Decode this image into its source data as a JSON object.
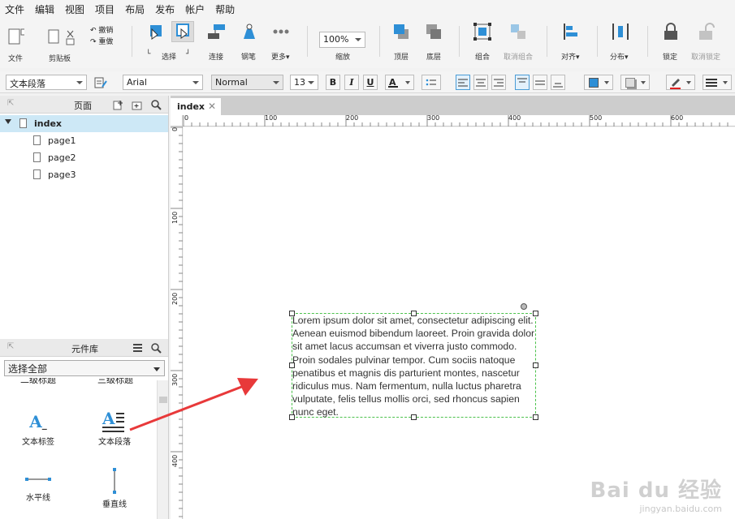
{
  "menu": [
    "文件",
    "编辑",
    "视图",
    "项目",
    "布局",
    "发布",
    "帐户",
    "帮助"
  ],
  "toolbar": {
    "file_label": "文件",
    "clipboard_label": "剪贴板",
    "undo_label": "撤销",
    "redo_label": "重做",
    "select_label": "选择",
    "connect_label": "连接",
    "pen_label": "钢笔",
    "more_label": "更多▾",
    "zoom_value": "100%",
    "zoom_label": "缩放",
    "top_label": "顶层",
    "bottom_label": "底层",
    "group_label": "组合",
    "ungroup_label": "取消组合",
    "align_label": "对齐▾",
    "distribute_label": "分布▾",
    "lock_label": "锁定",
    "unlock_label": "取消锁定"
  },
  "format": {
    "widget_style": "文本段落",
    "font": "Arial",
    "font_style": "Normal",
    "font_size": "13",
    "bold": "B",
    "italic": "I",
    "underline": "U",
    "text_color_glyph": "A"
  },
  "pages_panel": {
    "title": "页面",
    "pages": [
      {
        "name": "index",
        "selected": true
      },
      {
        "name": "page1"
      },
      {
        "name": "page2"
      },
      {
        "name": "page3"
      }
    ]
  },
  "library_panel": {
    "title": "元件库",
    "filter": "选择全部",
    "partial_labels": [
      "二级标题",
      "三级标题"
    ],
    "items": [
      {
        "label": "文本标签",
        "icon": "text-label-icon"
      },
      {
        "label": "文本段落",
        "icon": "text-paragraph-icon"
      },
      {
        "label": "水平线",
        "icon": "horizontal-line-icon"
      },
      {
        "label": "垂直线",
        "icon": "vertical-line-icon"
      }
    ]
  },
  "canvas": {
    "tab_name": "index",
    "ruler_top": [
      "0",
      "100",
      "200",
      "300",
      "400",
      "500",
      "600"
    ],
    "ruler_left": [
      "0",
      "100",
      "200",
      "300",
      "400"
    ],
    "paragraph_text": "Lorem ipsum dolor sit amet, consectetur adipiscing elit. Aenean euismod bibendum laoreet. Proin gravida dolor sit amet lacus accumsan et viverra justo commodo. Proin sodales pulvinar tempor. Cum sociis natoque penatibus et magnis dis parturient montes, nascetur ridiculus mus. Nam fermentum, nulla luctus pharetra vulputate, felis tellus mollis orci, sed rhoncus sapien nunc eget."
  },
  "watermark": {
    "logo": "Bai du 经验",
    "url": "jingyan.baidu.com"
  },
  "colors": {
    "accent": "#2e8fd6",
    "selection": "#cde8f6",
    "arrow": "#e8393a",
    "widget_border": "#4cc24c"
  }
}
